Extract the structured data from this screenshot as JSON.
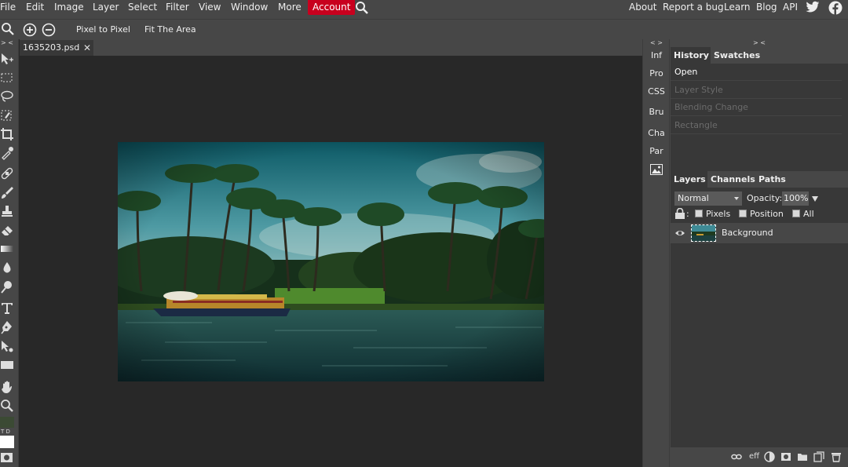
{
  "menu": {
    "items": [
      "File",
      "Edit",
      "Image",
      "Layer",
      "Select",
      "Filter",
      "View",
      "Window",
      "More"
    ],
    "account": "Account",
    "right": [
      "About",
      "Report a bug",
      "Learn",
      "Blog",
      "API"
    ]
  },
  "options": {
    "pixel_to_pixel": "Pixel to Pixel",
    "fit_area": "Fit The Area"
  },
  "toolbar": {
    "collapse": "> <",
    "swap_labels": "T D"
  },
  "document": {
    "tab_name": "1635203.psd",
    "close": "✕"
  },
  "mini_panels": {
    "collapse": "< >",
    "items": [
      "Inf",
      "Pro",
      "CSS",
      "Bru",
      "Cha",
      "Par"
    ]
  },
  "right_panels": {
    "collapse": "> <",
    "history_tabs": [
      "History",
      "Swatches"
    ],
    "history_items": [
      {
        "label": "Open",
        "state": "current"
      },
      {
        "label": "Layer Style",
        "state": "future"
      },
      {
        "label": "Blending Change",
        "state": "future"
      },
      {
        "label": "Rectangle",
        "state": "future"
      }
    ],
    "layer_tabs": [
      "Layers",
      "Channels",
      "Paths"
    ],
    "blend_mode": "Normal",
    "opacity_label": "Opacity:",
    "opacity_value": "100%",
    "lock_colon": ":",
    "lock_pixels": "Pixels",
    "lock_position": "Position",
    "lock_all": "All",
    "layer_name": "Background",
    "footer_eff": "eff"
  },
  "colors": {
    "menubar": "#474747",
    "canvas_bg": "#282828",
    "account": "#c8001e",
    "foreground_color": "#3b4a34",
    "background_color": "#ffffff"
  }
}
